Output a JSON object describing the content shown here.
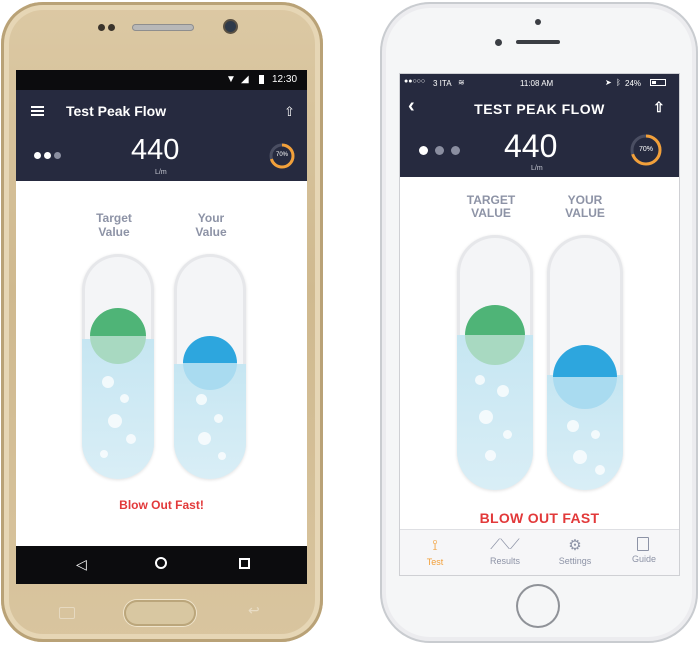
{
  "android": {
    "status": {
      "time": "12:30"
    },
    "header": {
      "title": "Test Peak Flow",
      "value": "440",
      "unit": "L/m",
      "progress_label": "70%",
      "progress": 0.7
    },
    "labels": {
      "target": "Target Value",
      "your": "Your Value"
    },
    "message": "Blow Out Fast!"
  },
  "iphone": {
    "status": {
      "carrier": "3 ITA",
      "time": "11:08 AM",
      "battery": "24%"
    },
    "header": {
      "title": "TEST PEAK FLOW",
      "value": "440",
      "unit": "L/m",
      "progress_label": "70%",
      "progress": 0.7
    },
    "labels": {
      "target": "TARGET VALUE",
      "your": "YOUR VALUE"
    },
    "message": "BLOW OUT FAST",
    "tabs": [
      {
        "label": "Test",
        "icon": "lungs-icon",
        "active": true
      },
      {
        "label": "Results",
        "icon": "chart-line-icon",
        "active": false
      },
      {
        "label": "Settings",
        "icon": "gear-icon",
        "active": false
      },
      {
        "label": "Guide",
        "icon": "book-icon",
        "active": false
      }
    ]
  },
  "colors": {
    "header": "#262a3f",
    "accent": "#f2a03a",
    "target": "#4fb477",
    "your": "#2da6de",
    "alert": "#e2393a"
  }
}
